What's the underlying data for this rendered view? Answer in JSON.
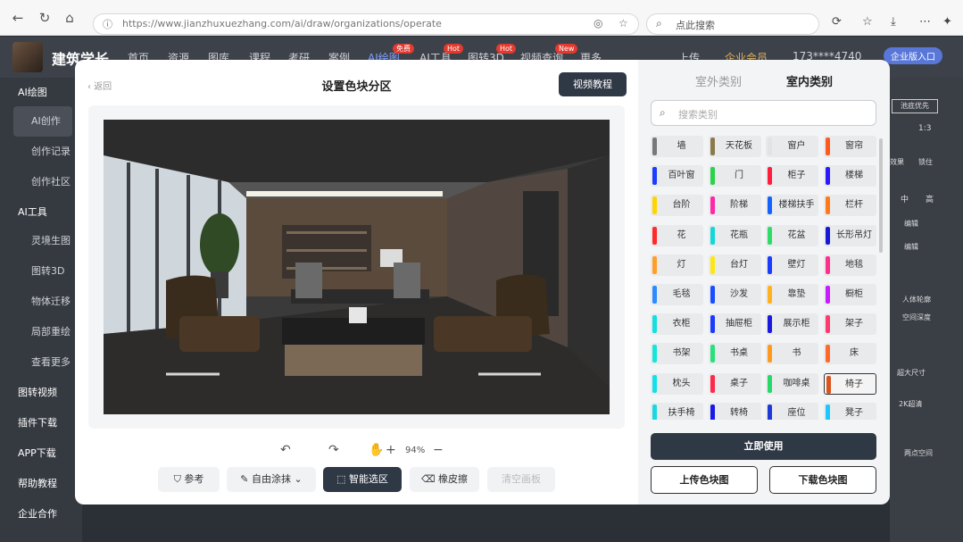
{
  "browser": {
    "url": "https://www.jianzhuxuezhang.com/ai/draw/organizations/operate",
    "search_placeholder": "点此搜索"
  },
  "site": {
    "logo": "建筑学长",
    "nav": [
      "首页",
      "资源",
      "图库",
      "课程",
      "考研",
      "案例",
      "AI绘图",
      "AI工具",
      "图转3D",
      "视频查询",
      "更多"
    ],
    "badges": {
      "ai_draw": "免费",
      "ai_tools": "Hot",
      "to3d": "Hot",
      "video": "New"
    },
    "upload": "上传",
    "member": "企业会员",
    "phone": "173****4740",
    "enterprise_entry": "企业版入口"
  },
  "sidebar": {
    "section_ai_draw": "AI绘图",
    "ai_create": "AI创作",
    "history": "创作记录",
    "community": "创作社区",
    "section_ai_tools": "AI工具",
    "linework": "灵境生图",
    "to3d": "图转3D",
    "object_move": "物体迁移",
    "local_erase": "局部重绘",
    "more": "查看更多",
    "image_video": "图转视频",
    "plugin": "插件下载",
    "app": "APP下载",
    "help": "帮助教程",
    "enterprise": "企业合作"
  },
  "right_bg": {
    "priority": "池底优先",
    "ratio": "1:3",
    "effect": "效果",
    "lock": "锁住",
    "mid": "中",
    "high": "高",
    "edit1": "编辑",
    "edit2": "编辑",
    "human": "人体轮廓",
    "depth": "空间深度",
    "size": "超大尺寸",
    "hd": "2K超清",
    "two_space": "两点空间"
  },
  "modal": {
    "back": "返回",
    "title": "设置色块分区",
    "video_tutorial": "视频教程",
    "zoom": "94%",
    "tools": {
      "reference": "参考",
      "free_paint": "自由涂抹",
      "smart_select": "智能选区",
      "eraser": "橡皮擦",
      "clear": "清空画板"
    },
    "tabs": {
      "outdoor": "室外类别",
      "indoor": "室内类别"
    },
    "search_placeholder": "搜索类别",
    "categories": [
      {
        "label": "墙",
        "color": "#787878"
      },
      {
        "label": "天花板",
        "color": "#8a7a4e"
      },
      {
        "label": "窗户",
        "color": "#e3e3e3"
      },
      {
        "label": "窗帘",
        "color": "#ff5a1f"
      },
      {
        "label": "百叶窗",
        "color": "#1a3dff"
      },
      {
        "label": "门",
        "color": "#2bd24a"
      },
      {
        "label": "柜子",
        "color": "#ff1e3c"
      },
      {
        "label": "楼梯",
        "color": "#2a1aff"
      },
      {
        "label": "台阶",
        "color": "#ffd500"
      },
      {
        "label": "阶梯",
        "color": "#ff28a8"
      },
      {
        "label": "楼梯扶手",
        "color": "#1463ff"
      },
      {
        "label": "栏杆",
        "color": "#ff7a18"
      },
      {
        "label": "花",
        "color": "#ff2a2a"
      },
      {
        "label": "花瓶",
        "color": "#12d8d8"
      },
      {
        "label": "花盆",
        "color": "#2fdc6a"
      },
      {
        "label": "长形吊灯",
        "color": "#1818d8"
      },
      {
        "label": "灯",
        "color": "#ff9f2a"
      },
      {
        "label": "台灯",
        "color": "#ffe612"
      },
      {
        "label": "壁灯",
        "color": "#1c3cff"
      },
      {
        "label": "地毯",
        "color": "#ff2f8a"
      },
      {
        "label": "毛毯",
        "color": "#2a8cff"
      },
      {
        "label": "沙发",
        "color": "#1a4dff"
      },
      {
        "label": "靠垫",
        "color": "#ffb21e"
      },
      {
        "label": "橱柜",
        "color": "#c81cff"
      },
      {
        "label": "衣柜",
        "color": "#12e0e0"
      },
      {
        "label": "抽屉柜",
        "color": "#1c3aff"
      },
      {
        "label": "展示柜",
        "color": "#1a1ae0"
      },
      {
        "label": "架子",
        "color": "#ff3a6e"
      },
      {
        "label": "书架",
        "color": "#14e6d8"
      },
      {
        "label": "书桌",
        "color": "#2ae07a"
      },
      {
        "label": "书",
        "color": "#ff9a1e"
      },
      {
        "label": "床",
        "color": "#ff6a2a"
      },
      {
        "label": "枕头",
        "color": "#14e0e8"
      },
      {
        "label": "桌子",
        "color": "#ff2a4a"
      },
      {
        "label": "咖啡桌",
        "color": "#28d86a"
      },
      {
        "label": "椅子",
        "color": "#d9541e"
      },
      {
        "label": "扶手椅",
        "color": "#1ad8e0"
      },
      {
        "label": "转椅",
        "color": "#1a1ae8"
      },
      {
        "label": "座位",
        "color": "#1d3ad8"
      },
      {
        "label": "凳子",
        "color": "#1ec8ff"
      }
    ],
    "selected_category": "椅子",
    "use_now": "立即使用",
    "upload_color": "上传色块图",
    "download_color": "下载色块图"
  }
}
